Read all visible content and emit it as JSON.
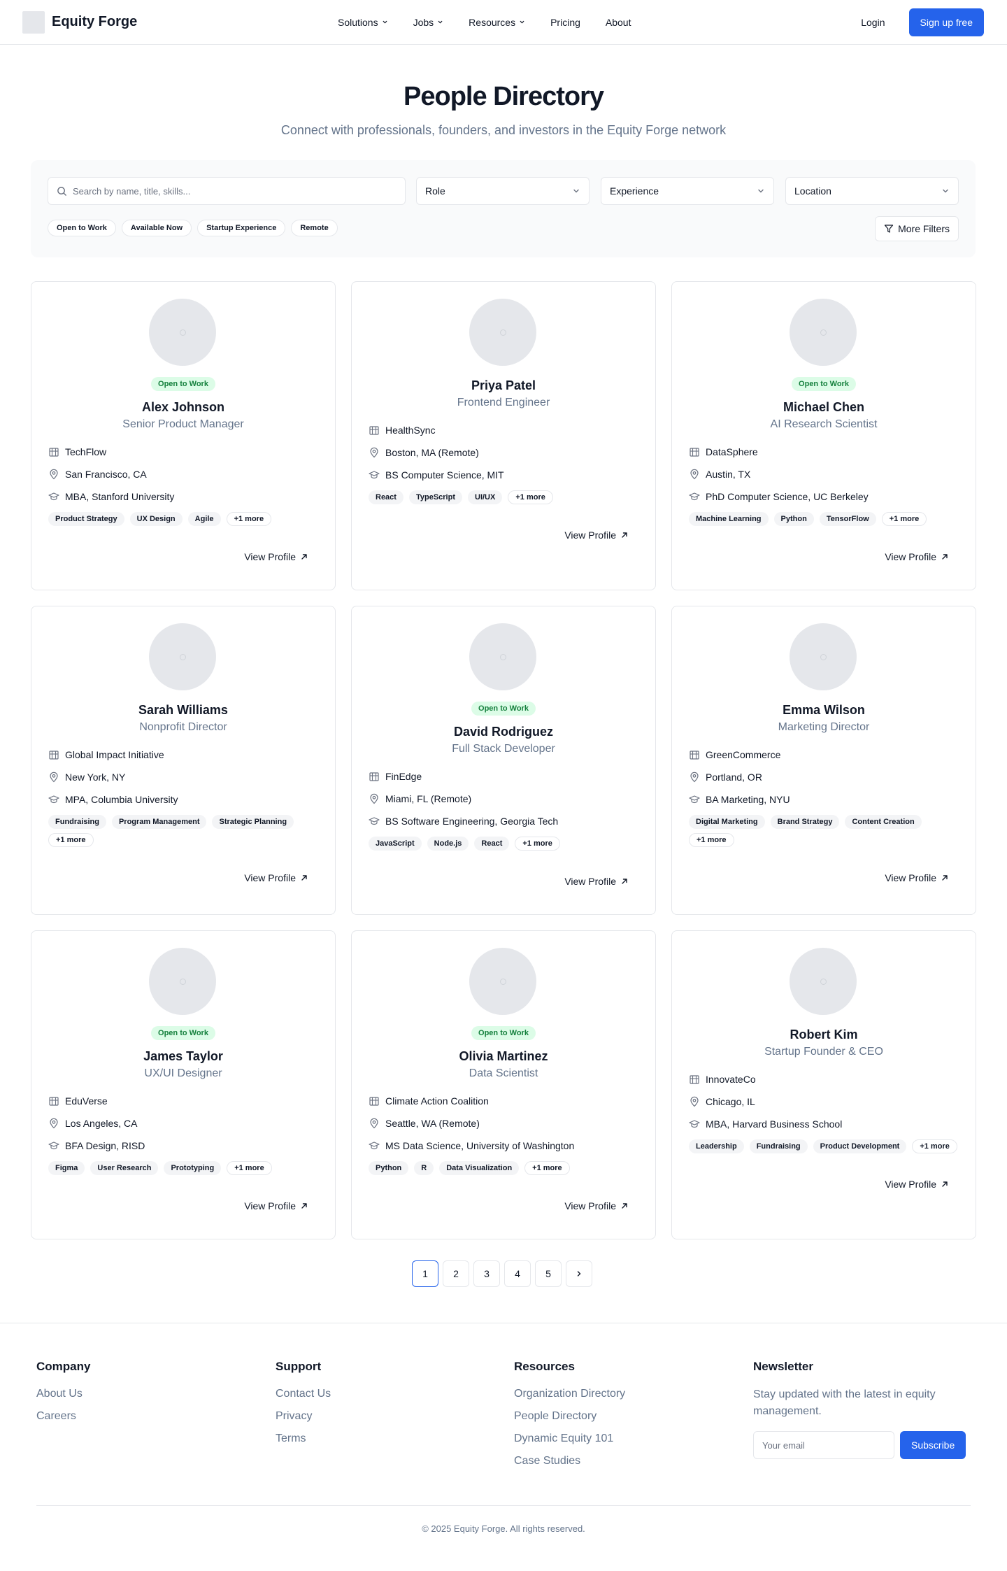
{
  "brand": {
    "name": "Equity Forge"
  },
  "nav": {
    "links": [
      {
        "label": "Solutions",
        "dropdown": true
      },
      {
        "label": "Jobs",
        "dropdown": true
      },
      {
        "label": "Resources",
        "dropdown": true
      },
      {
        "label": "Pricing",
        "dropdown": false
      },
      {
        "label": "About",
        "dropdown": false
      }
    ],
    "login": "Login",
    "signup": "Sign up free"
  },
  "hero": {
    "title": "People Directory",
    "subtitle": "Connect with professionals, founders, and investors in the Equity Forge network"
  },
  "filters": {
    "search_placeholder": "Search by name, title, skills...",
    "role": "Role",
    "experience": "Experience",
    "location": "Location",
    "chips": [
      "Open to Work",
      "Available Now",
      "Startup Experience",
      "Remote"
    ],
    "more_filters": "More Filters"
  },
  "people": [
    {
      "name": "Alex Johnson",
      "title": "Senior Product Manager",
      "open_to_work": true,
      "company": "TechFlow",
      "location": "San Francisco, CA",
      "education": "MBA, Stanford University",
      "skills": [
        "Product Strategy",
        "UX Design",
        "Agile"
      ],
      "more": "+1 more"
    },
    {
      "name": "Priya Patel",
      "title": "Frontend Engineer",
      "open_to_work": false,
      "company": "HealthSync",
      "location": "Boston, MA (Remote)",
      "education": "BS Computer Science, MIT",
      "skills": [
        "React",
        "TypeScript",
        "UI/UX"
      ],
      "more": "+1 more"
    },
    {
      "name": "Michael Chen",
      "title": "AI Research Scientist",
      "open_to_work": true,
      "company": "DataSphere",
      "location": "Austin, TX",
      "education": "PhD Computer Science, UC Berkeley",
      "skills": [
        "Machine Learning",
        "Python",
        "TensorFlow"
      ],
      "more": "+1 more"
    },
    {
      "name": "Sarah Williams",
      "title": "Nonprofit Director",
      "open_to_work": false,
      "company": "Global Impact Initiative",
      "location": "New York, NY",
      "education": "MPA, Columbia University",
      "skills": [
        "Fundraising",
        "Program Management",
        "Strategic Planning"
      ],
      "more": "+1 more"
    },
    {
      "name": "David Rodriguez",
      "title": "Full Stack Developer",
      "open_to_work": true,
      "company": "FinEdge",
      "location": "Miami, FL (Remote)",
      "education": "BS Software Engineering, Georgia Tech",
      "skills": [
        "JavaScript",
        "Node.js",
        "React"
      ],
      "more": "+1 more"
    },
    {
      "name": "Emma Wilson",
      "title": "Marketing Director",
      "open_to_work": false,
      "company": "GreenCommerce",
      "location": "Portland, OR",
      "education": "BA Marketing, NYU",
      "skills": [
        "Digital Marketing",
        "Brand Strategy",
        "Content Creation"
      ],
      "more": "+1 more"
    },
    {
      "name": "James Taylor",
      "title": "UX/UI Designer",
      "open_to_work": true,
      "company": "EduVerse",
      "location": "Los Angeles, CA",
      "education": "BFA Design, RISD",
      "skills": [
        "Figma",
        "User Research",
        "Prototyping"
      ],
      "more": "+1 more"
    },
    {
      "name": "Olivia Martinez",
      "title": "Data Scientist",
      "open_to_work": true,
      "company": "Climate Action Coalition",
      "location": "Seattle, WA (Remote)",
      "education": "MS Data Science, University of Washington",
      "skills": [
        "Python",
        "R",
        "Data Visualization"
      ],
      "more": "+1 more"
    },
    {
      "name": "Robert Kim",
      "title": "Startup Founder & CEO",
      "open_to_work": false,
      "company": "InnovateCo",
      "location": "Chicago, IL",
      "education": "MBA, Harvard Business School",
      "skills": [
        "Leadership",
        "Fundraising",
        "Product Development"
      ],
      "more": "+1 more"
    }
  ],
  "card_labels": {
    "open_to_work": "Open to Work",
    "view_profile": "View Profile"
  },
  "pagination": {
    "pages": [
      "1",
      "2",
      "3",
      "4",
      "5"
    ],
    "active": "1"
  },
  "footer": {
    "company": {
      "title": "Company",
      "links": [
        "About Us",
        "Careers"
      ]
    },
    "support": {
      "title": "Support",
      "links": [
        "Contact Us",
        "Privacy",
        "Terms"
      ]
    },
    "resources": {
      "title": "Resources",
      "links": [
        "Organization Directory",
        "People Directory",
        "Dynamic Equity 101",
        "Case Studies"
      ]
    },
    "newsletter": {
      "title": "Newsletter",
      "text": "Stay updated with the latest in equity management.",
      "placeholder": "Your email",
      "button": "Subscribe"
    },
    "copyright": "© 2025 Equity Forge. All rights reserved."
  },
  "colors": {
    "accent": "#2563eb",
    "badge_bg": "#dcfce7",
    "badge_text": "#15803d"
  }
}
